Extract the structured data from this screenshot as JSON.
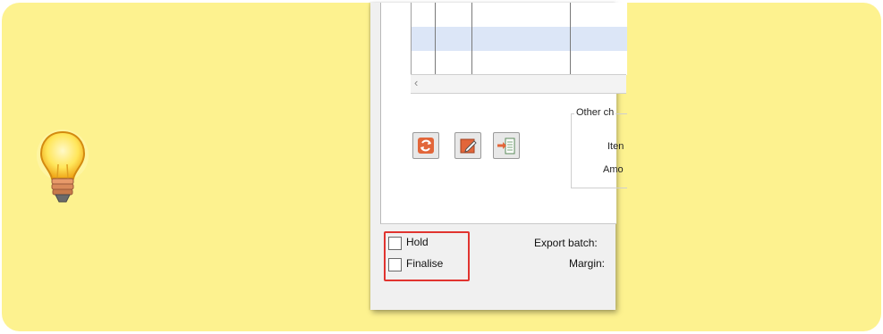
{
  "window": {
    "group_title": "Other ch",
    "field_labels": [
      "Iten",
      "Amo"
    ],
    "toolbar": [
      {
        "icon": "refresh-icon"
      },
      {
        "icon": "edit-icon"
      },
      {
        "icon": "import-icon"
      }
    ],
    "checkboxes": {
      "hold": {
        "label": "Hold",
        "checked": false
      },
      "finalise": {
        "label": "Finalise",
        "checked": false
      }
    },
    "bottom_labels": {
      "export_batch": "Export batch:",
      "margin": "Margin:"
    }
  },
  "colors": {
    "callout_bg": "#fdf28f",
    "highlight": "#e1342f",
    "selected_row": "#dce6f7"
  },
  "decoration": {
    "icon": "lightbulb-icon"
  }
}
